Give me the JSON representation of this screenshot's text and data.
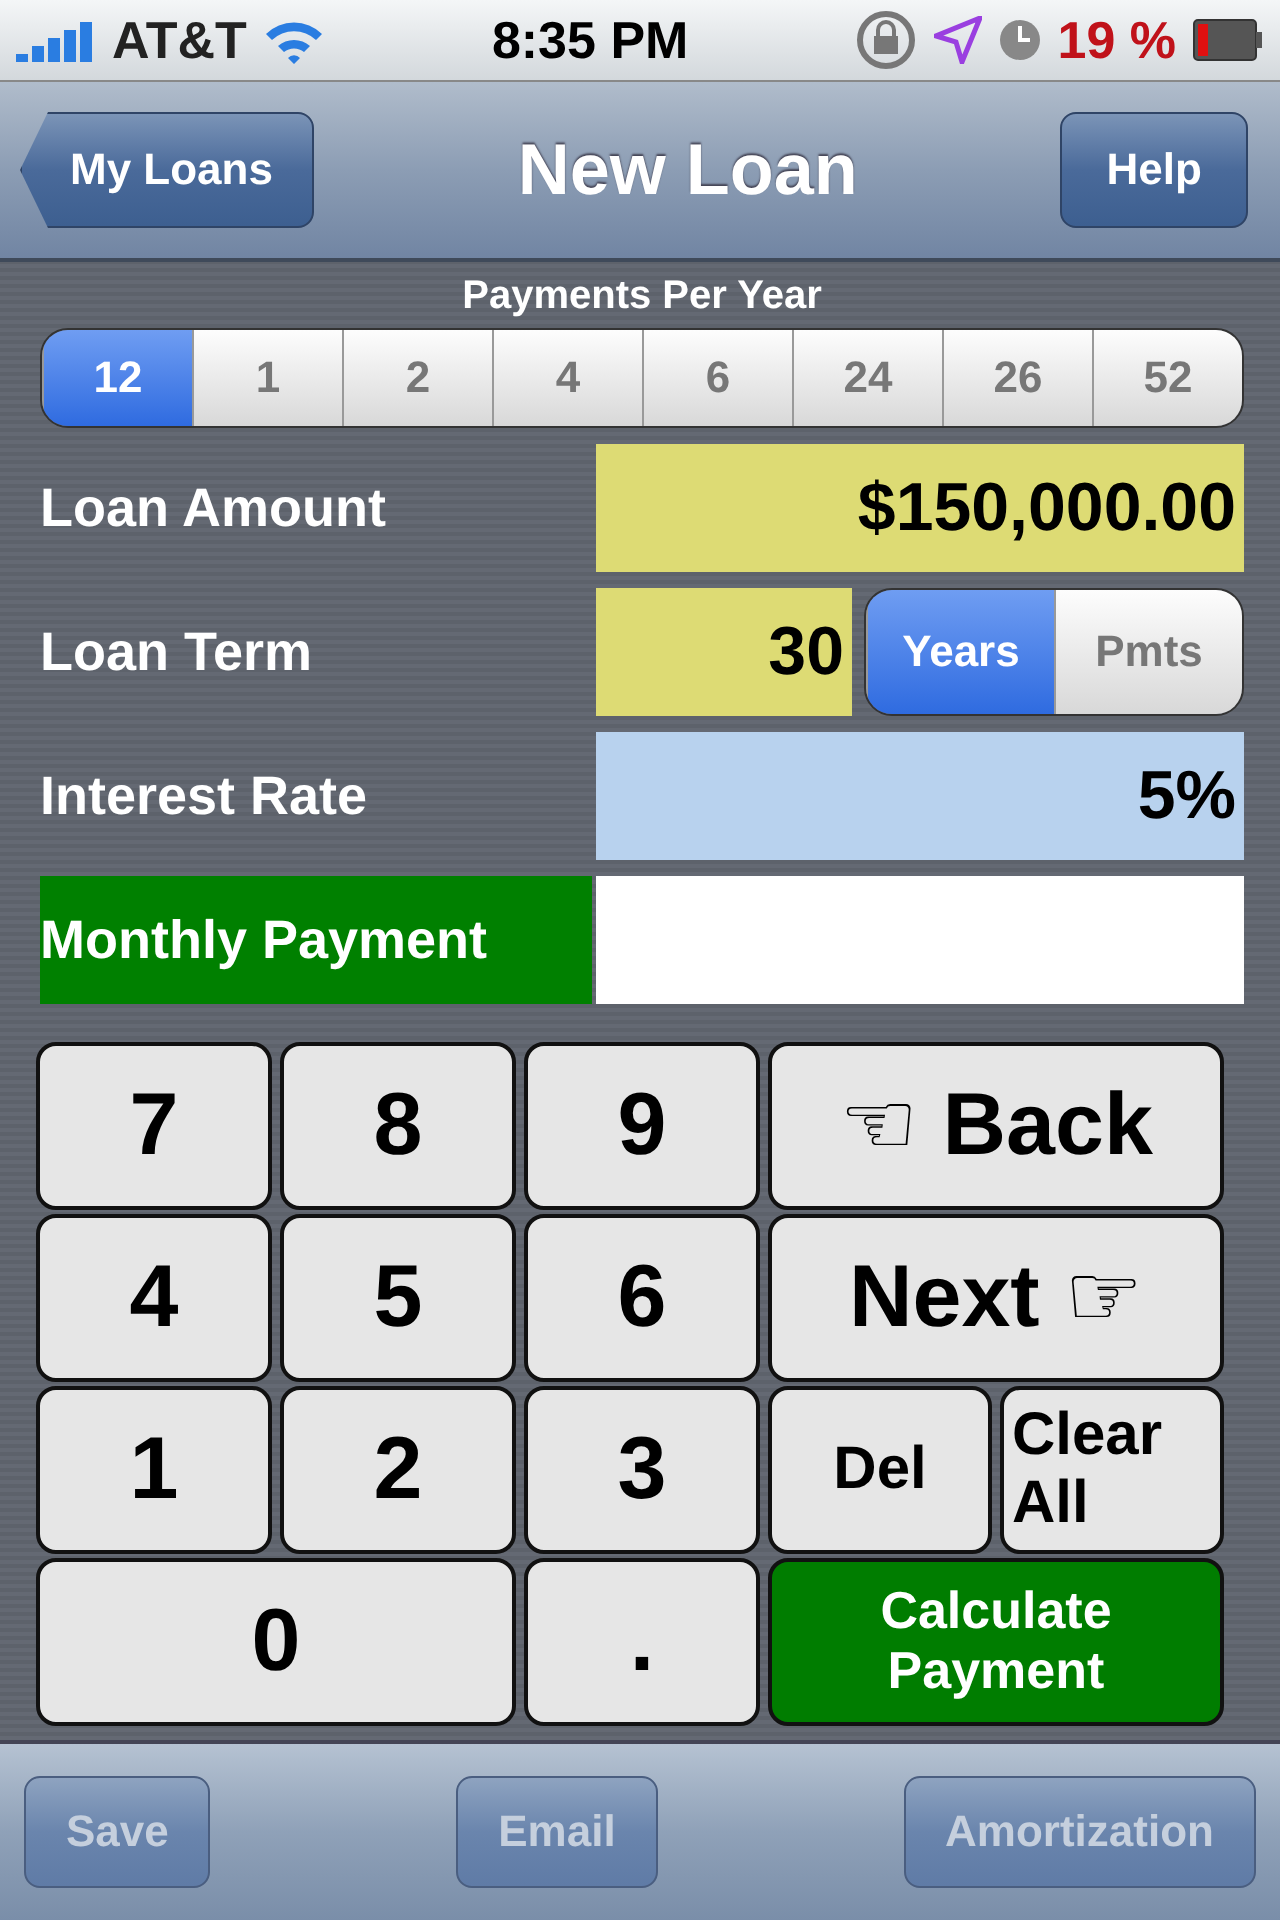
{
  "status_bar": {
    "carrier": "AT&T",
    "time": "8:35 PM",
    "battery": "19 %"
  },
  "nav": {
    "back": "My Loans",
    "title": "New Loan",
    "right": "Help"
  },
  "payments": {
    "label": "Payments Per Year",
    "options": [
      {
        "label": "12",
        "selected": true
      },
      {
        "label": "1",
        "selected": false
      },
      {
        "label": "2",
        "selected": false
      },
      {
        "label": "4",
        "selected": false
      },
      {
        "label": "6",
        "selected": false
      },
      {
        "label": "24",
        "selected": false
      },
      {
        "label": "26",
        "selected": false
      },
      {
        "label": "52",
        "selected": false
      }
    ]
  },
  "fields": [
    {
      "label": "Loan Amount",
      "value": "$150,000.00",
      "kind": "amount"
    },
    {
      "label": "Loan Term",
      "value": "30",
      "kind": "term",
      "units": [
        {
          "label": "Years",
          "selected": true
        },
        {
          "label": "Pmts",
          "selected": false
        }
      ]
    },
    {
      "label": "Interest Rate",
      "value": "5%",
      "kind": "rate"
    },
    {
      "label": "Monthly Payment",
      "kind": "result"
    }
  ],
  "keys": [
    {
      "label": "7",
      "kind": "key"
    },
    {
      "label": "8",
      "kind": "key"
    },
    {
      "label": "9",
      "kind": "key"
    },
    {
      "label": "☜ Back",
      "kind": "wide"
    },
    {
      "label": "4",
      "kind": "key"
    },
    {
      "label": "5",
      "kind": "key"
    },
    {
      "label": "6",
      "kind": "key"
    },
    {
      "label": "Next ☞",
      "kind": "wide"
    },
    {
      "label": "1",
      "kind": "key"
    },
    {
      "label": "2",
      "kind": "key"
    },
    {
      "label": "3",
      "kind": "key"
    },
    {
      "label": "Del",
      "kind": "word"
    },
    {
      "label": "Clear All",
      "kind": "small"
    },
    {
      "label": "0",
      "kind": "wide"
    },
    {
      "label": ".",
      "kind": "key"
    },
    {
      "label": "Calculate Payment",
      "kind": "green"
    }
  ],
  "toolbar": [
    {
      "label": "Save",
      "disabled": true
    },
    {
      "label": "Email",
      "disabled": true
    },
    {
      "label": "Amortization",
      "disabled": true
    }
  ]
}
